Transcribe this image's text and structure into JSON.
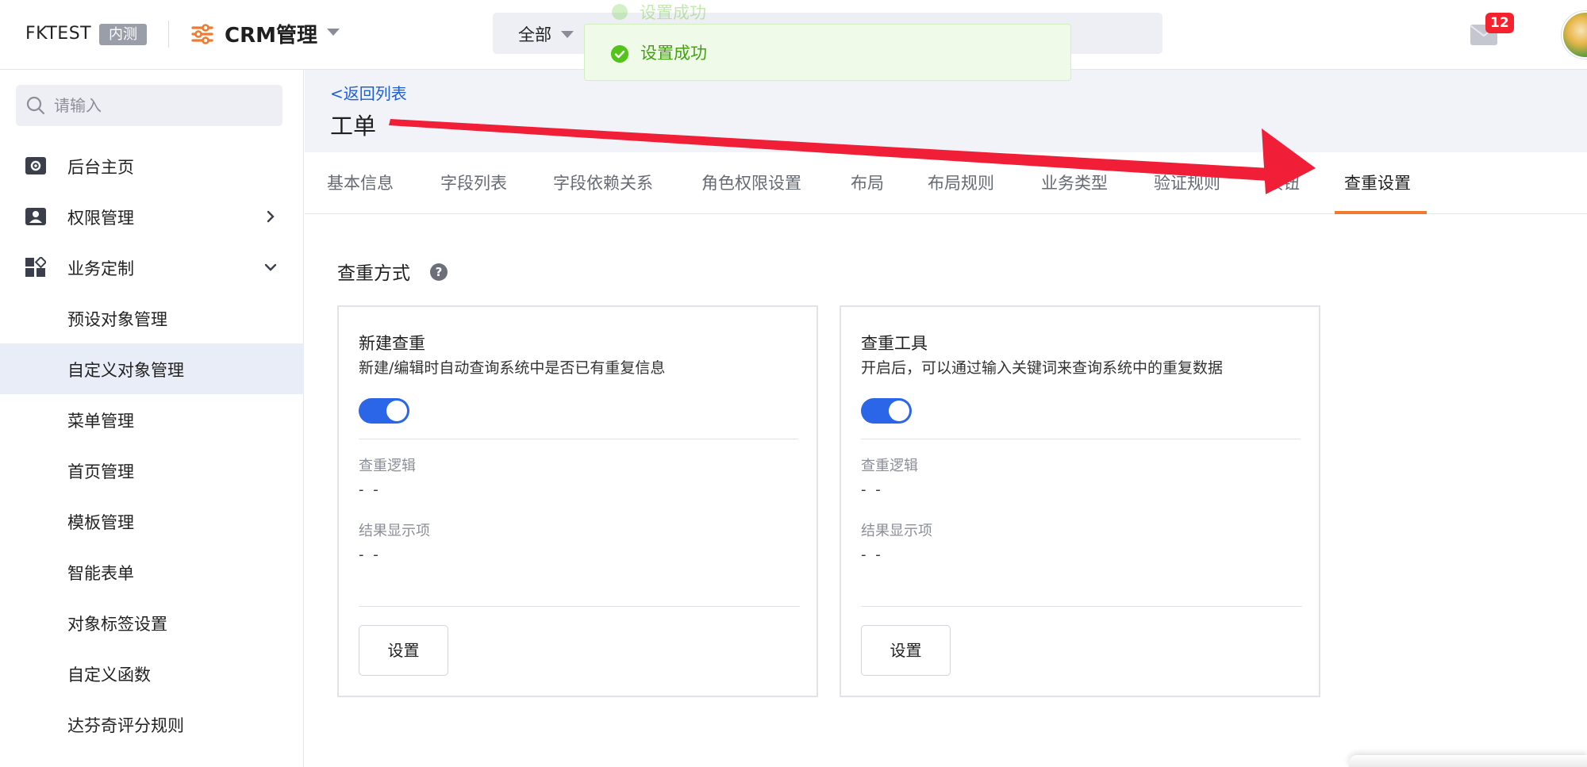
{
  "header": {
    "org_name": "FKTEST",
    "org_badge": "内测",
    "app_title": "CRM管理",
    "search_scope": "全部",
    "mail_count": "12"
  },
  "toasts": {
    "ghost": "设置成功",
    "main": "设置成功",
    "accent_color": "#52c41a"
  },
  "sidebar": {
    "search_placeholder": "请输入",
    "items": [
      {
        "label": "后台主页",
        "icon": "dashboard-icon"
      },
      {
        "label": "权限管理",
        "icon": "user-card-icon"
      },
      {
        "label": "业务定制",
        "icon": "apps-icon"
      }
    ],
    "sub_items": [
      {
        "label": "预设对象管理"
      },
      {
        "label": "自定义对象管理",
        "active": true
      },
      {
        "label": "菜单管理"
      },
      {
        "label": "首页管理"
      },
      {
        "label": "模板管理"
      },
      {
        "label": "智能表单"
      },
      {
        "label": "对象标签设置"
      },
      {
        "label": "自定义函数"
      },
      {
        "label": "达芬奇评分规则"
      }
    ]
  },
  "page": {
    "back_link": "<返回列表",
    "title": "工单",
    "tabs": [
      {
        "label": "基本信息"
      },
      {
        "label": "字段列表"
      },
      {
        "label": "字段依赖关系"
      },
      {
        "label": "角色权限设置"
      },
      {
        "label": "布局"
      },
      {
        "label": "布局规则"
      },
      {
        "label": "业务类型"
      },
      {
        "label": "验证规则"
      },
      {
        "label": "按钮"
      },
      {
        "label": "查重设置",
        "active": true
      }
    ],
    "section_title": "查重方式",
    "active_tab_color": "#f07a30"
  },
  "cards": [
    {
      "title": "新建查重",
      "desc": "新建/编辑时自动查询系统中是否已有重复信息",
      "enabled": true,
      "logic_label": "查重逻辑",
      "logic_value": "- -",
      "result_label": "结果显示项",
      "result_value": "- -",
      "button": "设置"
    },
    {
      "title": "查重工具",
      "desc": "开启后，可以通过输入关键词来查询系统中的重复数据",
      "enabled": true,
      "logic_label": "查重逻辑",
      "logic_value": "- -",
      "result_label": "结果显示项",
      "result_value": "- -",
      "button": "设置"
    }
  ]
}
